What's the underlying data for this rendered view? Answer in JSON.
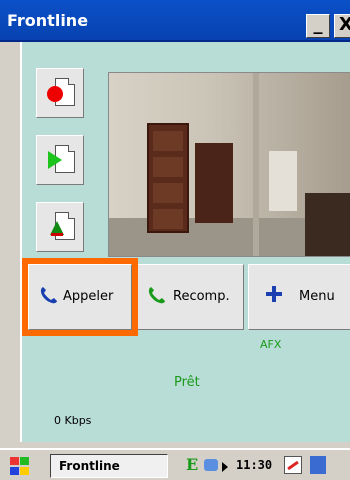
{
  "window": {
    "title": "Frontline",
    "minimize_glyph": "_",
    "close_glyph": "X"
  },
  "side_buttons": [
    {
      "name": "record",
      "icon": "record-dot-icon"
    },
    {
      "name": "play",
      "icon": "play-icon"
    },
    {
      "name": "picture",
      "icon": "picture-icon"
    }
  ],
  "actions": {
    "call_label": "Appeler",
    "redial_label": "Recomp.",
    "menu_label": "Menu"
  },
  "status": {
    "codec": "AFX",
    "state": "Prêt",
    "bitrate": "0 Kbps"
  },
  "taskbar": {
    "task_label": "Frontline",
    "tray_letter": "E",
    "clock": "11:30"
  },
  "colors": {
    "title_bar": "#0a50c8",
    "panel_bg": "#b8dcd6",
    "highlight": "#ff6a00",
    "status_text": "#1a9a1a"
  }
}
